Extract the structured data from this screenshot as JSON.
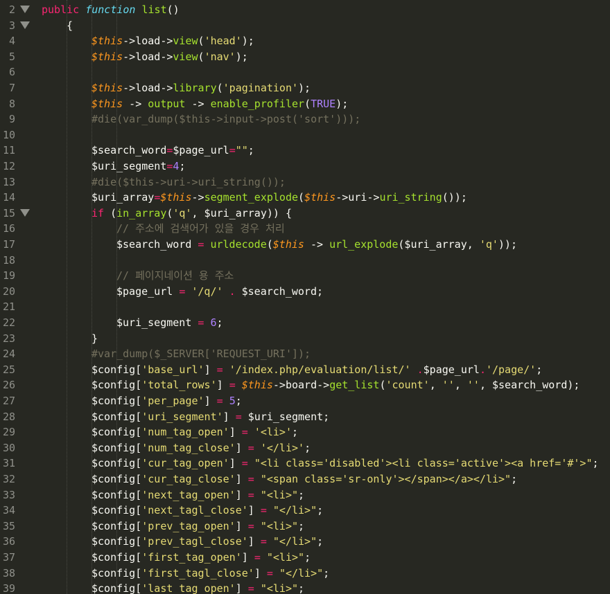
{
  "editor": {
    "theme": "monokai",
    "colors": {
      "background": "#272822",
      "plain": "#f8f8f2",
      "keyword": "#f92672",
      "storage": "#66d9ef",
      "function": "#a6e22e",
      "variable": "#fd971f",
      "string": "#e6db74",
      "comment": "#75715e",
      "constant": "#ae81ff",
      "gutter": "#8f908a"
    },
    "fold_icon": "triangle-down-icon",
    "lines": [
      {
        "n": "2",
        "fold": true,
        "indent": 0,
        "tokens": [
          [
            "kw",
            "public"
          ],
          [
            "ws",
            " "
          ],
          [
            "sto",
            "function"
          ],
          [
            "ws",
            " "
          ],
          [
            "fn",
            "list"
          ],
          [
            "pl",
            "()"
          ]
        ]
      },
      {
        "n": "3",
        "fold": true,
        "indent": 1,
        "tokens": [
          [
            "pl",
            "{"
          ]
        ]
      },
      {
        "n": "4",
        "fold": false,
        "indent": 2,
        "tokens": [
          [
            "vr",
            "$this"
          ],
          [
            "pl",
            "->load->"
          ],
          [
            "sto_n",
            "view"
          ],
          [
            "pl",
            "("
          ],
          [
            "st",
            "'head'"
          ],
          [
            "pl",
            ");"
          ]
        ]
      },
      {
        "n": "5",
        "fold": false,
        "indent": 2,
        "tokens": [
          [
            "vr",
            "$this"
          ],
          [
            "pl",
            "->load->"
          ],
          [
            "sto_n",
            "view"
          ],
          [
            "pl",
            "("
          ],
          [
            "st",
            "'nav'"
          ],
          [
            "pl",
            ");"
          ]
        ]
      },
      {
        "n": "6",
        "fold": false,
        "indent": 0,
        "tokens": []
      },
      {
        "n": "7",
        "fold": false,
        "indent": 2,
        "tokens": [
          [
            "vr",
            "$this"
          ],
          [
            "pl",
            "->load->"
          ],
          [
            "sto_n",
            "library"
          ],
          [
            "pl",
            "("
          ],
          [
            "st",
            "'pagination'"
          ],
          [
            "pl",
            ");"
          ]
        ]
      },
      {
        "n": "8",
        "fold": false,
        "indent": 2,
        "tokens": [
          [
            "vr",
            "$this"
          ],
          [
            "pl",
            " -> "
          ],
          [
            "sto_n",
            "output"
          ],
          [
            "pl",
            " -> "
          ],
          [
            "sto_n",
            "enable_profiler"
          ],
          [
            "pl",
            "("
          ],
          [
            "cn",
            "TRUE"
          ],
          [
            "pl",
            ");"
          ]
        ]
      },
      {
        "n": "9",
        "fold": false,
        "indent": 2,
        "tokens": [
          [
            "cm",
            "#die(var_dump($this->input->post('sort')));"
          ]
        ]
      },
      {
        "n": "10",
        "fold": false,
        "indent": 0,
        "tokens": []
      },
      {
        "n": "11",
        "fold": false,
        "indent": 2,
        "tokens": [
          [
            "pl",
            "$search_word"
          ],
          [
            "kw",
            "="
          ],
          [
            "pl",
            "$page_url"
          ],
          [
            "kw",
            "="
          ],
          [
            "st",
            "\"\""
          ],
          [
            "pl",
            ";"
          ]
        ]
      },
      {
        "n": "12",
        "fold": false,
        "indent": 2,
        "tokens": [
          [
            "pl",
            "$uri_segment"
          ],
          [
            "kw",
            "="
          ],
          [
            "cn",
            "4"
          ],
          [
            "pl",
            ";"
          ]
        ]
      },
      {
        "n": "13",
        "fold": false,
        "indent": 2,
        "tokens": [
          [
            "cm",
            "#die($this->uri->uri_string());"
          ]
        ]
      },
      {
        "n": "14",
        "fold": false,
        "indent": 2,
        "tokens": [
          [
            "pl",
            "$uri_array"
          ],
          [
            "kw",
            "="
          ],
          [
            "vr",
            "$this"
          ],
          [
            "pl",
            "->"
          ],
          [
            "sto_n",
            "segment_explode"
          ],
          [
            "pl",
            "("
          ],
          [
            "vr",
            "$this"
          ],
          [
            "pl",
            "->uri->"
          ],
          [
            "sto_n",
            "uri_string"
          ],
          [
            "pl",
            "());"
          ]
        ]
      },
      {
        "n": "15",
        "fold": true,
        "indent": 2,
        "tokens": [
          [
            "kw",
            "if"
          ],
          [
            "pl",
            " ("
          ],
          [
            "sto_n",
            "in_array"
          ],
          [
            "pl",
            "("
          ],
          [
            "st",
            "'q'"
          ],
          [
            "pl",
            ", $uri_array)) {"
          ]
        ]
      },
      {
        "n": "16",
        "fold": false,
        "indent": 3,
        "tokens": [
          [
            "cm",
            "// 주소에 검색어가 있을 경우 처리"
          ]
        ]
      },
      {
        "n": "17",
        "fold": false,
        "indent": 3,
        "tokens": [
          [
            "pl",
            "$search_word "
          ],
          [
            "kw",
            "="
          ],
          [
            "pl",
            " "
          ],
          [
            "sto_n",
            "urldecode"
          ],
          [
            "pl",
            "("
          ],
          [
            "vr",
            "$this"
          ],
          [
            "pl",
            " -> "
          ],
          [
            "sto_n",
            "url_explode"
          ],
          [
            "pl",
            "($uri_array, "
          ],
          [
            "st",
            "'q'"
          ],
          [
            "pl",
            "));"
          ]
        ]
      },
      {
        "n": "18",
        "fold": false,
        "indent": 0,
        "tokens": []
      },
      {
        "n": "19",
        "fold": false,
        "indent": 3,
        "tokens": [
          [
            "cm",
            "// 페이지네이션 용 주소"
          ]
        ]
      },
      {
        "n": "20",
        "fold": false,
        "indent": 3,
        "tokens": [
          [
            "pl",
            "$page_url "
          ],
          [
            "kw",
            "="
          ],
          [
            "pl",
            " "
          ],
          [
            "st",
            "'/q/'"
          ],
          [
            "pl",
            " "
          ],
          [
            "kw",
            "."
          ],
          [
            "pl",
            " $search_word;"
          ]
        ]
      },
      {
        "n": "21",
        "fold": false,
        "indent": 0,
        "tokens": []
      },
      {
        "n": "22",
        "fold": false,
        "indent": 3,
        "tokens": [
          [
            "pl",
            "$uri_segment "
          ],
          [
            "kw",
            "="
          ],
          [
            "pl",
            " "
          ],
          [
            "cn",
            "6"
          ],
          [
            "pl",
            ";"
          ]
        ]
      },
      {
        "n": "23",
        "fold": false,
        "indent": 2,
        "tokens": [
          [
            "pl",
            "}"
          ]
        ]
      },
      {
        "n": "24",
        "fold": false,
        "indent": 2,
        "tokens": [
          [
            "cm",
            "#var_dump($_SERVER['REQUEST_URI']);"
          ]
        ]
      },
      {
        "n": "25",
        "fold": false,
        "indent": 2,
        "tokens": [
          [
            "pl",
            "$config["
          ],
          [
            "st",
            "'base_url'"
          ],
          [
            "pl",
            "] "
          ],
          [
            "kw",
            "="
          ],
          [
            "pl",
            " "
          ],
          [
            "st",
            "'/index.php/evaluation/list/'"
          ],
          [
            "pl",
            " "
          ],
          [
            "kw",
            "."
          ],
          [
            "pl",
            "$page_url"
          ],
          [
            "kw",
            "."
          ],
          [
            "st",
            "'/page/'"
          ],
          [
            "pl",
            ";"
          ]
        ]
      },
      {
        "n": "26",
        "fold": false,
        "indent": 2,
        "tokens": [
          [
            "pl",
            "$config["
          ],
          [
            "st",
            "'total_rows'"
          ],
          [
            "pl",
            "] "
          ],
          [
            "kw",
            "="
          ],
          [
            "pl",
            " "
          ],
          [
            "vr",
            "$this"
          ],
          [
            "pl",
            "->board->"
          ],
          [
            "sto_n",
            "get_list"
          ],
          [
            "pl",
            "("
          ],
          [
            "st",
            "'count'"
          ],
          [
            "pl",
            ", "
          ],
          [
            "st",
            "''"
          ],
          [
            "pl",
            ", "
          ],
          [
            "st",
            "''"
          ],
          [
            "pl",
            ", $search_word);"
          ]
        ]
      },
      {
        "n": "27",
        "fold": false,
        "indent": 2,
        "tokens": [
          [
            "pl",
            "$config["
          ],
          [
            "st",
            "'per_page'"
          ],
          [
            "pl",
            "] "
          ],
          [
            "kw",
            "="
          ],
          [
            "pl",
            " "
          ],
          [
            "cn",
            "5"
          ],
          [
            "pl",
            ";"
          ]
        ]
      },
      {
        "n": "28",
        "fold": false,
        "indent": 2,
        "tokens": [
          [
            "pl",
            "$config["
          ],
          [
            "st",
            "'uri_segment'"
          ],
          [
            "pl",
            "] "
          ],
          [
            "kw",
            "="
          ],
          [
            "pl",
            " $uri_segment;"
          ]
        ]
      },
      {
        "n": "29",
        "fold": false,
        "indent": 2,
        "tokens": [
          [
            "pl",
            "$config["
          ],
          [
            "st",
            "'num_tag_open'"
          ],
          [
            "pl",
            "] "
          ],
          [
            "kw",
            "="
          ],
          [
            "pl",
            " "
          ],
          [
            "st",
            "'<li>'"
          ],
          [
            "pl",
            ";"
          ]
        ]
      },
      {
        "n": "30",
        "fold": false,
        "indent": 2,
        "tokens": [
          [
            "pl",
            "$config["
          ],
          [
            "st",
            "'num_tag_close'"
          ],
          [
            "pl",
            "] "
          ],
          [
            "kw",
            "="
          ],
          [
            "pl",
            " "
          ],
          [
            "st",
            "'</li>'"
          ],
          [
            "pl",
            ";"
          ]
        ]
      },
      {
        "n": "31",
        "fold": false,
        "indent": 2,
        "tokens": [
          [
            "pl",
            "$config["
          ],
          [
            "st",
            "'cur_tag_open'"
          ],
          [
            "pl",
            "] "
          ],
          [
            "kw",
            "="
          ],
          [
            "pl",
            " "
          ],
          [
            "st",
            "\"<li class='disabled'><li class='active'><a href='#'>\""
          ],
          [
            "pl",
            ";"
          ]
        ]
      },
      {
        "n": "32",
        "fold": false,
        "indent": 2,
        "tokens": [
          [
            "pl",
            "$config["
          ],
          [
            "st",
            "'cur_tag_close'"
          ],
          [
            "pl",
            "] "
          ],
          [
            "kw",
            "="
          ],
          [
            "pl",
            " "
          ],
          [
            "st",
            "\"<span class='sr-only'></span></a></li>\""
          ],
          [
            "pl",
            ";"
          ]
        ]
      },
      {
        "n": "33",
        "fold": false,
        "indent": 2,
        "tokens": [
          [
            "pl",
            "$config["
          ],
          [
            "st",
            "'next_tag_open'"
          ],
          [
            "pl",
            "] "
          ],
          [
            "kw",
            "="
          ],
          [
            "pl",
            " "
          ],
          [
            "st",
            "\"<li>\""
          ],
          [
            "pl",
            ";"
          ]
        ]
      },
      {
        "n": "34",
        "fold": false,
        "indent": 2,
        "tokens": [
          [
            "pl",
            "$config["
          ],
          [
            "st",
            "'next_tagl_close'"
          ],
          [
            "pl",
            "] "
          ],
          [
            "kw",
            "="
          ],
          [
            "pl",
            " "
          ],
          [
            "st",
            "\"</li>\""
          ],
          [
            "pl",
            ";"
          ]
        ]
      },
      {
        "n": "35",
        "fold": false,
        "indent": 2,
        "tokens": [
          [
            "pl",
            "$config["
          ],
          [
            "st",
            "'prev_tag_open'"
          ],
          [
            "pl",
            "] "
          ],
          [
            "kw",
            "="
          ],
          [
            "pl",
            " "
          ],
          [
            "st",
            "\"<li>\""
          ],
          [
            "pl",
            ";"
          ]
        ]
      },
      {
        "n": "36",
        "fold": false,
        "indent": 2,
        "tokens": [
          [
            "pl",
            "$config["
          ],
          [
            "st",
            "'prev_tagl_close'"
          ],
          [
            "pl",
            "] "
          ],
          [
            "kw",
            "="
          ],
          [
            "pl",
            " "
          ],
          [
            "st",
            "\"</li>\""
          ],
          [
            "pl",
            ";"
          ]
        ]
      },
      {
        "n": "37",
        "fold": false,
        "indent": 2,
        "tokens": [
          [
            "pl",
            "$config["
          ],
          [
            "st",
            "'first_tag_open'"
          ],
          [
            "pl",
            "] "
          ],
          [
            "kw",
            "="
          ],
          [
            "pl",
            " "
          ],
          [
            "st",
            "\"<li>\""
          ],
          [
            "pl",
            ";"
          ]
        ]
      },
      {
        "n": "38",
        "fold": false,
        "indent": 2,
        "tokens": [
          [
            "pl",
            "$config["
          ],
          [
            "st",
            "'first_tagl_close'"
          ],
          [
            "pl",
            "] "
          ],
          [
            "kw",
            "="
          ],
          [
            "pl",
            " "
          ],
          [
            "st",
            "\"</li>\""
          ],
          [
            "pl",
            ";"
          ]
        ]
      },
      {
        "n": "39",
        "fold": false,
        "indent": 2,
        "tokens": [
          [
            "pl",
            "$config["
          ],
          [
            "st",
            "'last_tag_open'"
          ],
          [
            "pl",
            "] "
          ],
          [
            "kw",
            "="
          ],
          [
            "pl",
            " "
          ],
          [
            "st",
            "\"<li>\""
          ],
          [
            "pl",
            ";"
          ]
        ]
      }
    ]
  }
}
